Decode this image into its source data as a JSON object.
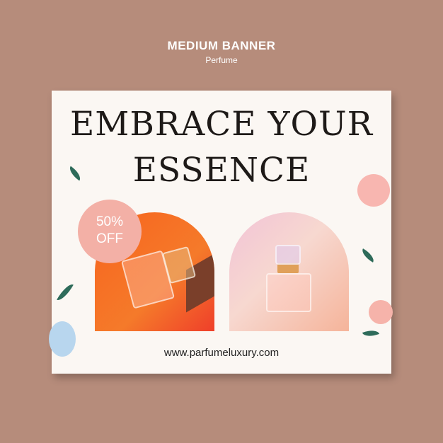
{
  "header": {
    "title": "MEDIUM BANNER",
    "subtitle": "Perfume"
  },
  "banner": {
    "headline_line1": "EMBRACE YOUR",
    "headline_line2": "ESSENCE",
    "badge_line1": "50%",
    "badge_line2": "OFF",
    "url": "www.parfumeluxury.com"
  },
  "colors": {
    "background": "#b68c7b",
    "card": "#fbf7f3",
    "badge": "#f3b0a6",
    "leaf": "#2e6b5a"
  }
}
